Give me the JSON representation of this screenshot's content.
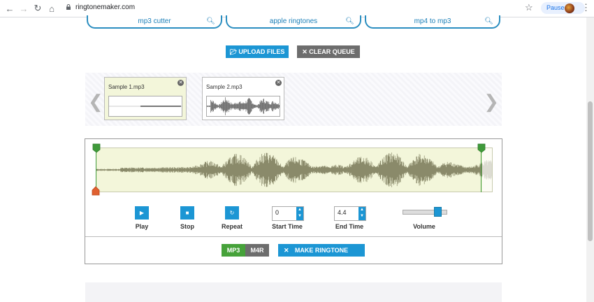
{
  "browser": {
    "url": "ringtonemaker.com",
    "paused_label": "Paused",
    "back_icon": "←",
    "forward_icon": "→",
    "reload_icon": "↻",
    "home_icon": "⌂",
    "star_icon": "☆",
    "menu_icon": "⋮"
  },
  "search_pills": [
    {
      "label": "mp3 cutter"
    },
    {
      "label": "apple ringtones"
    },
    {
      "label": "mp4 to mp3"
    }
  ],
  "toolbar": {
    "upload_label": "UPLOAD FILES",
    "clear_label": "CLEAR QUEUE"
  },
  "files": [
    {
      "name": "Sample 1.mp3",
      "selected": true
    },
    {
      "name": "Sample 2.mp3",
      "selected": false
    }
  ],
  "controls": {
    "play_label": "Play",
    "stop_label": "Stop",
    "repeat_label": "Repeat",
    "start_time_label": "Start Time",
    "start_time_value": "0",
    "end_time_label": "End Time",
    "end_time_value": "4.4",
    "volume_label": "Volume",
    "volume_level": 0.8
  },
  "formats": {
    "mp3_label": "MP3",
    "m4r_label": "M4R",
    "selected": "MP3"
  },
  "make_ringtone_label": "MAKE RINGTONE",
  "colors": {
    "accent": "#1c96d4",
    "green": "#46a23a",
    "gray": "#6d6d6d",
    "marker_start": "#e06030",
    "marker_green": "#3f9a3a",
    "wave_bg": "#f3f6da"
  }
}
